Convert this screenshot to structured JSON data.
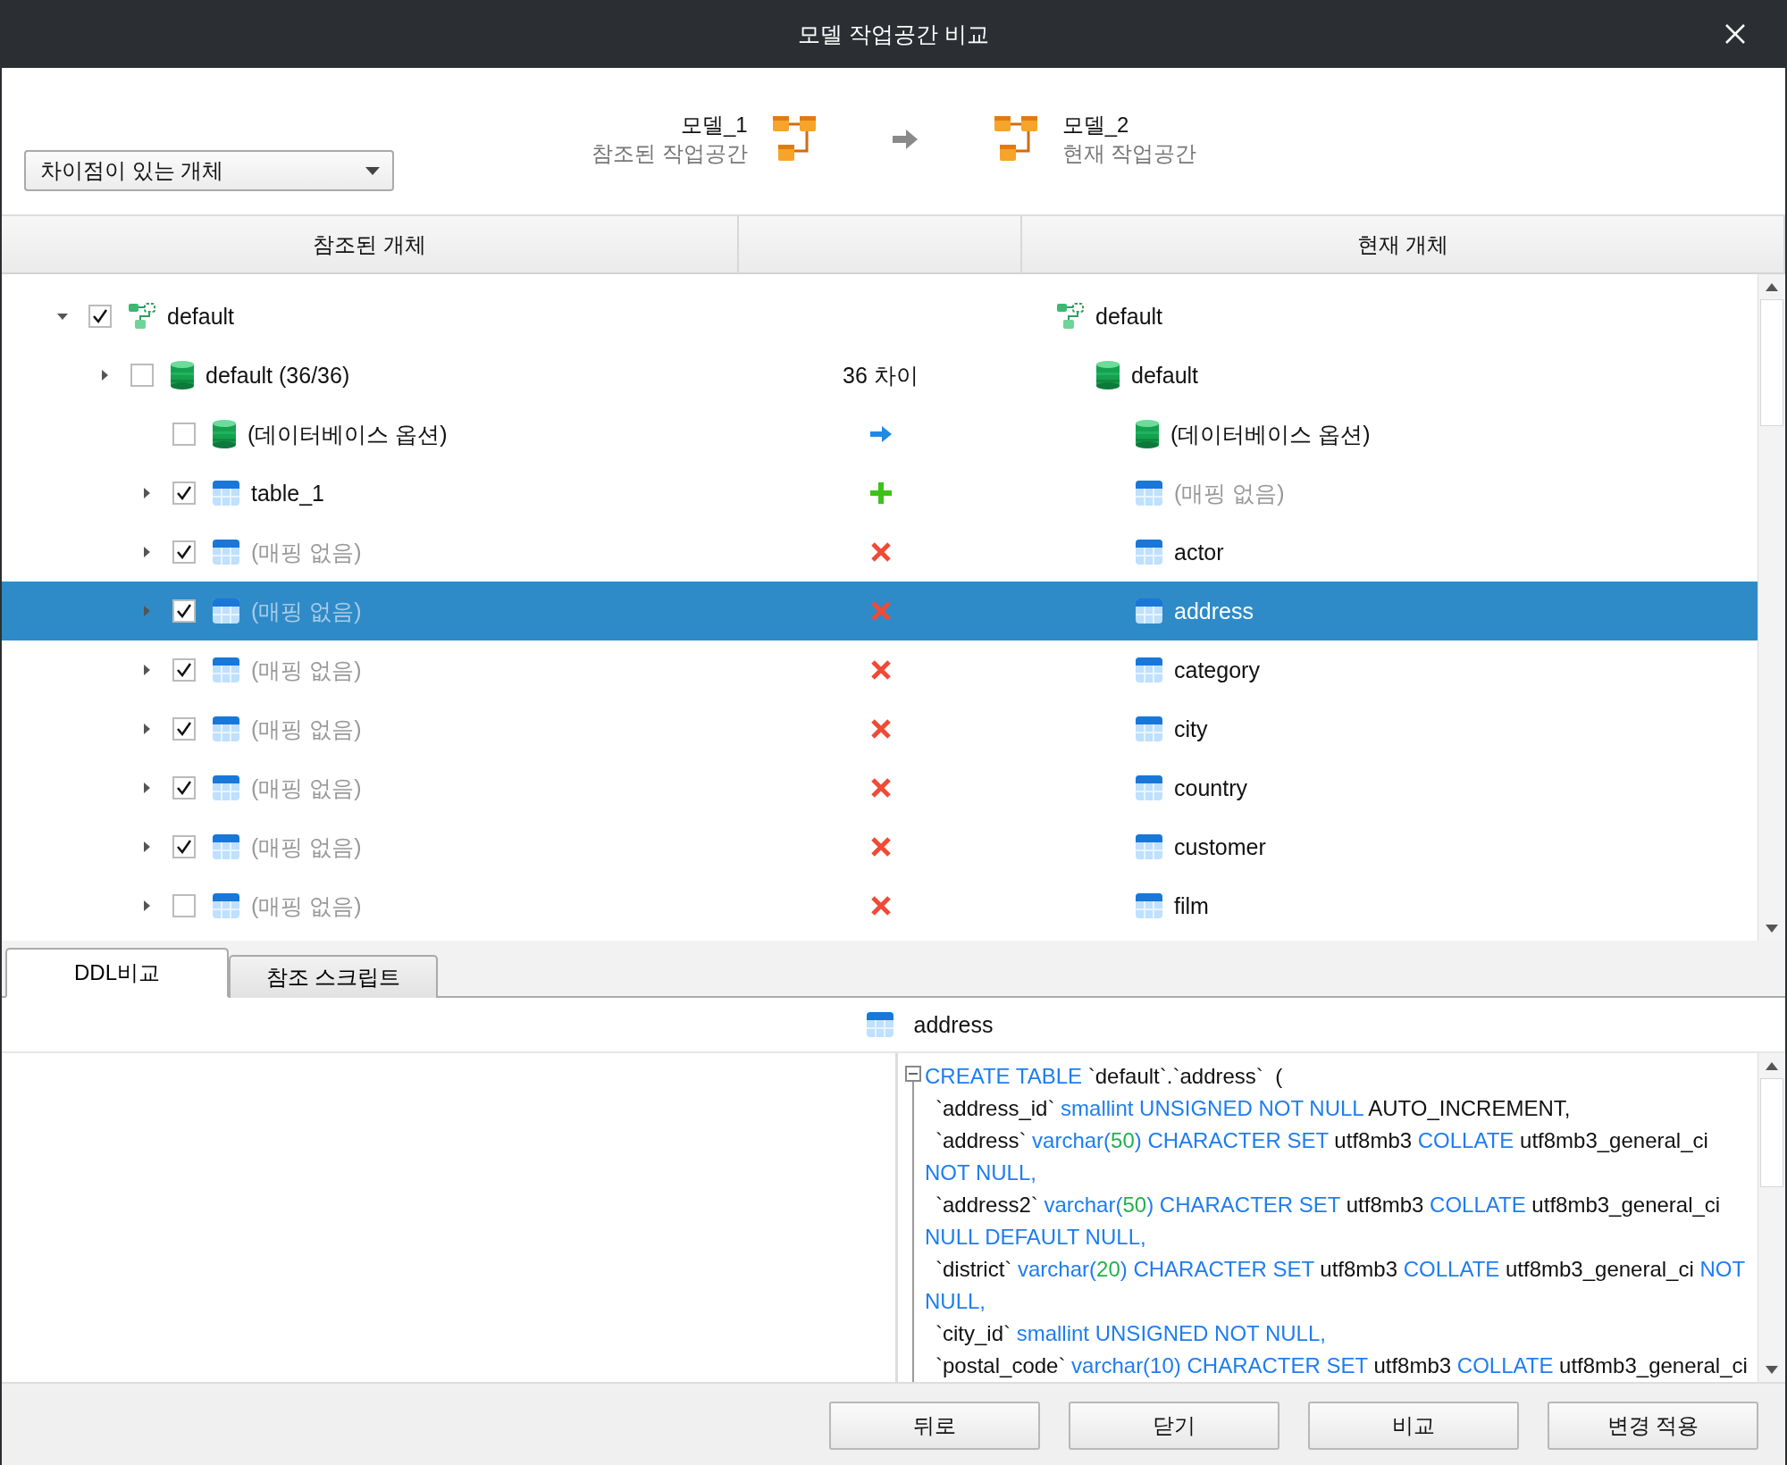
{
  "window": {
    "title": "모델 작업공간 비교"
  },
  "filter": {
    "value": "차이점이 있는 개체"
  },
  "source_model": {
    "name": "모델_1",
    "subtitle": "참조된 작업공간"
  },
  "target_model": {
    "name": "모델_2",
    "subtitle": "현재 작업공간"
  },
  "columns": [
    "참조된 개체",
    "현재 개체"
  ],
  "tree": [
    {
      "label": "default",
      "kind": "schema",
      "checked": true,
      "expanded": true,
      "muted": false,
      "selected": false,
      "target": {
        "label": "default",
        "kind": "schema",
        "muted": false
      },
      "children": [
        {
          "label": "default (36/36)",
          "kind": "database",
          "checked": false,
          "expanded": false,
          "muted": false,
          "selected": false,
          "diff": {
            "kind": "count",
            "text": "36 차이"
          },
          "target": {
            "label": "default",
            "kind": "database",
            "muted": false
          },
          "children": [
            {
              "label": "(데이터베이스 옵션)",
              "kind": "database",
              "checked": false,
              "muted": false,
              "selected": false,
              "diff": {
                "kind": "update"
              },
              "target": {
                "label": "(데이터베이스 옵션)",
                "kind": "database",
                "muted": false
              }
            },
            {
              "label": "table_1",
              "kind": "table",
              "checked": true,
              "expanded": false,
              "muted": false,
              "selected": false,
              "diff": {
                "kind": "add"
              },
              "target": {
                "label": "(매핑 없음)",
                "kind": "table",
                "muted": true
              }
            },
            {
              "label": "(매핑 없음)",
              "kind": "table",
              "checked": true,
              "expanded": false,
              "muted": true,
              "selected": false,
              "diff": {
                "kind": "remove"
              },
              "target": {
                "label": "actor",
                "kind": "table",
                "muted": false
              }
            },
            {
              "label": "(매핑 없음)",
              "kind": "table",
              "checked": true,
              "expanded": false,
              "muted": true,
              "selected": true,
              "diff": {
                "kind": "remove"
              },
              "target": {
                "label": "address",
                "kind": "table",
                "muted": false
              }
            },
            {
              "label": "(매핑 없음)",
              "kind": "table",
              "checked": true,
              "expanded": false,
              "muted": true,
              "selected": false,
              "diff": {
                "kind": "remove"
              },
              "target": {
                "label": "category",
                "kind": "table",
                "muted": false
              }
            },
            {
              "label": "(매핑 없음)",
              "kind": "table",
              "checked": true,
              "expanded": false,
              "muted": true,
              "selected": false,
              "diff": {
                "kind": "remove"
              },
              "target": {
                "label": "city",
                "kind": "table",
                "muted": false
              }
            },
            {
              "label": "(매핑 없음)",
              "kind": "table",
              "checked": true,
              "expanded": false,
              "muted": true,
              "selected": false,
              "diff": {
                "kind": "remove"
              },
              "target": {
                "label": "country",
                "kind": "table",
                "muted": false
              }
            },
            {
              "label": "(매핑 없음)",
              "kind": "table",
              "checked": true,
              "expanded": false,
              "muted": true,
              "selected": false,
              "diff": {
                "kind": "remove"
              },
              "target": {
                "label": "customer",
                "kind": "table",
                "muted": false
              }
            },
            {
              "label": "(매핑 없음)",
              "kind": "table",
              "checked": false,
              "expanded": false,
              "muted": true,
              "selected": false,
              "diff": {
                "kind": "remove"
              },
              "target": {
                "label": "film",
                "kind": "table",
                "muted": false
              }
            }
          ]
        }
      ]
    }
  ],
  "tabs": [
    {
      "label": "DDL비교",
      "selected": true
    },
    {
      "label": "참조 스크립트",
      "selected": false
    }
  ],
  "detail": {
    "title": "address"
  },
  "code": [
    {
      "indent": false,
      "fold": true,
      "tokens": [
        {
          "kind": "kw",
          "text": "CREATE TABLE"
        },
        {
          "kind": "plain",
          "text": " `default`.`address`  ("
        }
      ]
    },
    {
      "indent": true,
      "tokens": [
        {
          "kind": "plain",
          "text": "`address_id` "
        },
        {
          "kind": "kw",
          "text": "smallint UNSIGNED NOT NULL"
        },
        {
          "kind": "plain",
          "text": " AUTO_INCREMENT,"
        }
      ]
    },
    {
      "indent": true,
      "tokens": [
        {
          "kind": "plain",
          "text": "`address` "
        },
        {
          "kind": "kw",
          "text": "varchar("
        },
        {
          "kind": "num",
          "text": "50"
        },
        {
          "kind": "kw",
          "text": ")"
        },
        {
          "kind": "kw",
          "text": " CHARACTER SET"
        },
        {
          "kind": "plain",
          "text": " utf8mb3 "
        },
        {
          "kind": "kw",
          "text": "COLLATE"
        },
        {
          "kind": "plain",
          "text": " utf8mb3_general_ci"
        }
      ]
    },
    {
      "indent": false,
      "tokens": [
        {
          "kind": "kw",
          "text": "NOT NULL,"
        }
      ]
    },
    {
      "indent": true,
      "tokens": [
        {
          "kind": "plain",
          "text": "`address2` "
        },
        {
          "kind": "kw",
          "text": "varchar("
        },
        {
          "kind": "num",
          "text": "50"
        },
        {
          "kind": "kw",
          "text": ")"
        },
        {
          "kind": "kw",
          "text": " CHARACTER SET"
        },
        {
          "kind": "plain",
          "text": " utf8mb3 "
        },
        {
          "kind": "kw",
          "text": "COLLATE"
        },
        {
          "kind": "plain",
          "text": " utf8mb3_general_ci"
        }
      ]
    },
    {
      "indent": false,
      "tokens": [
        {
          "kind": "kw",
          "text": "NULL DEFAULT NULL,"
        }
      ]
    },
    {
      "indent": true,
      "tokens": [
        {
          "kind": "plain",
          "text": "`district` "
        },
        {
          "kind": "kw",
          "text": "varchar("
        },
        {
          "kind": "num",
          "text": "20"
        },
        {
          "kind": "kw",
          "text": ")"
        },
        {
          "kind": "kw",
          "text": " CHARACTER SET"
        },
        {
          "kind": "plain",
          "text": " utf8mb3 "
        },
        {
          "kind": "kw",
          "text": "COLLATE"
        },
        {
          "kind": "plain",
          "text": " utf8mb3_general_ci "
        },
        {
          "kind": "kw",
          "text": "NOT"
        }
      ]
    },
    {
      "indent": false,
      "tokens": [
        {
          "kind": "kw",
          "text": "NULL,"
        }
      ]
    },
    {
      "indent": true,
      "tokens": [
        {
          "kind": "plain",
          "text": "`city_id` "
        },
        {
          "kind": "kw",
          "text": "smallint UNSIGNED NOT NULL,"
        }
      ]
    },
    {
      "indent": true,
      "tokens": [
        {
          "kind": "plain",
          "text": "`postal_code` "
        },
        {
          "kind": "kw",
          "text": "varchar(10)"
        },
        {
          "kind": "kw",
          "text": " CHARACTER SET"
        },
        {
          "kind": "plain",
          "text": " utf8mb3 "
        },
        {
          "kind": "kw",
          "text": "COLLATE"
        },
        {
          "kind": "plain",
          "text": " utf8mb3_general_ci"
        }
      ]
    }
  ],
  "buttons": [
    "뒤로",
    "닫기",
    "비교",
    "변경 적용"
  ]
}
